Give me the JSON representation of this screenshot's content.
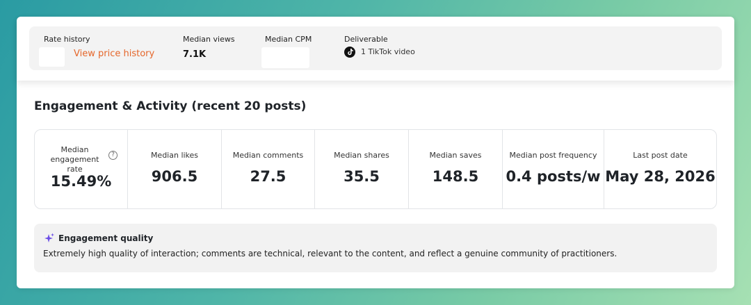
{
  "rate_history": {
    "label": "Rate history",
    "link": "View price history"
  },
  "median_views": {
    "label": "Median views",
    "value": "7.1K"
  },
  "median_cpm": {
    "label": "Median CPM"
  },
  "deliverable": {
    "label": "Deliverable",
    "icon": "tiktok-icon",
    "text": "1 TikTok video"
  },
  "engagement": {
    "title": "Engagement & Activity (recent 20 posts)",
    "stats": [
      {
        "label": "Median engagement rate",
        "value": "15.49%"
      },
      {
        "label": "Median likes",
        "value": "906.5"
      },
      {
        "label": "Median comments",
        "value": "27.5"
      },
      {
        "label": "Median shares",
        "value": "35.5"
      },
      {
        "label": "Median saves",
        "value": "148.5"
      },
      {
        "label": "Median post frequency",
        "value": "0.4 posts/w"
      },
      {
        "label": "Last post date",
        "value": "May 28, 2026"
      }
    ]
  },
  "quality": {
    "icon": "sparkle-icon",
    "title": "Engagement quality",
    "text": "Extremely high quality of interaction; comments are technical, relevant to the content, and reflect a genuine community of practitioners."
  },
  "colors": {
    "accent": "#e5662a",
    "sparkle": "#6c4ee6"
  }
}
